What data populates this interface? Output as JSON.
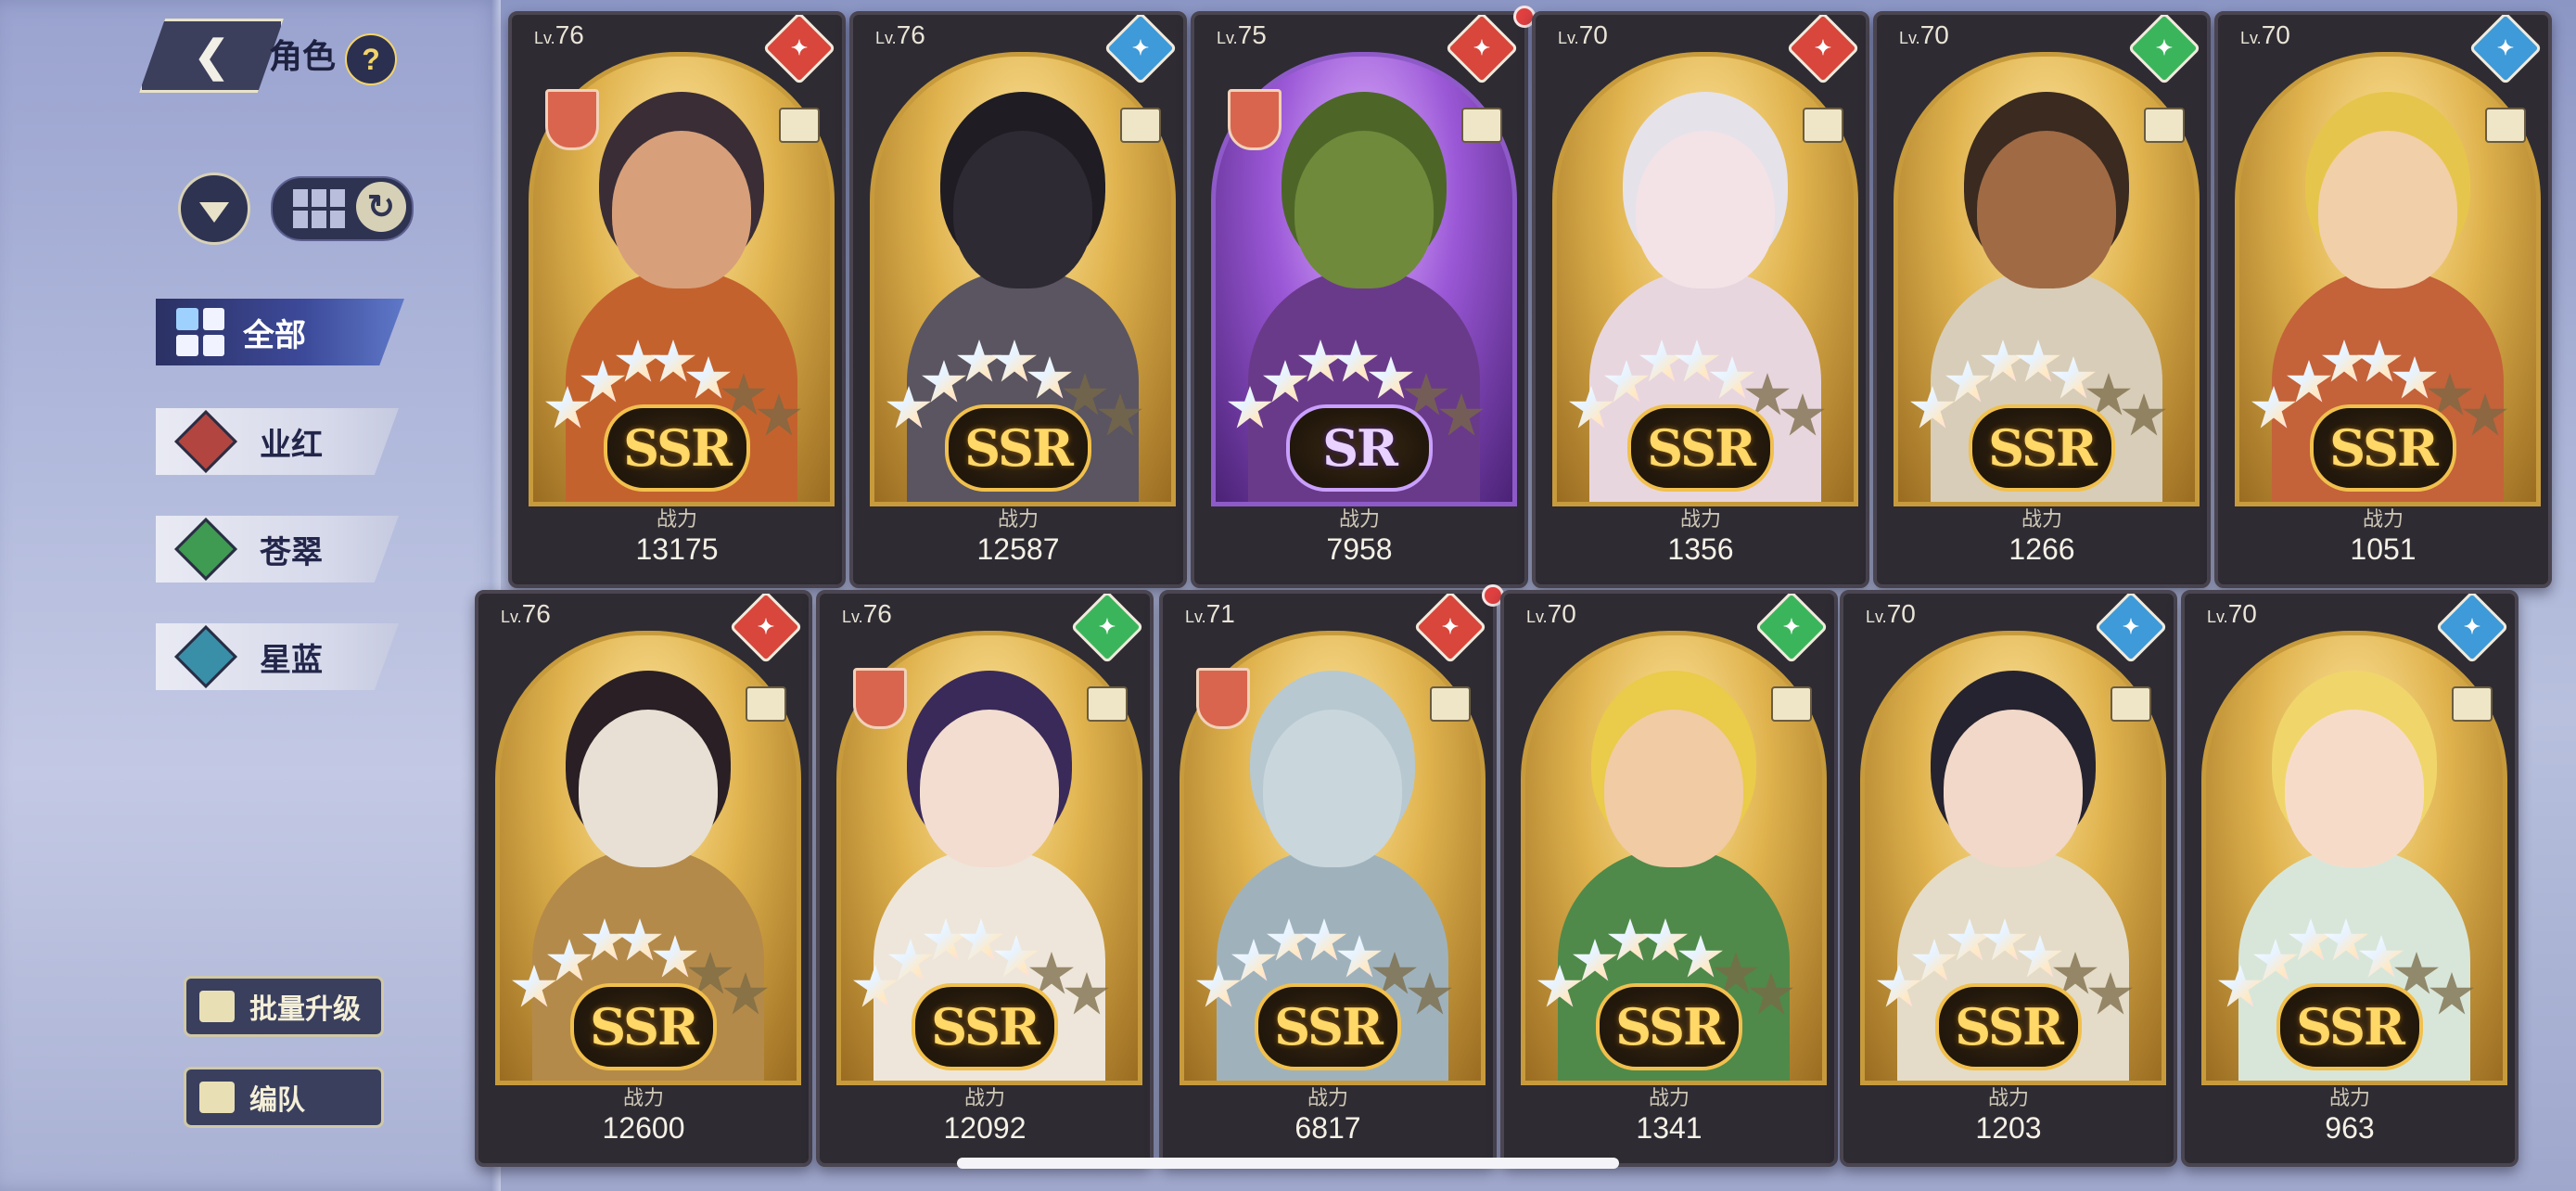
{
  "header": {
    "title": "角色",
    "help_icon": "?"
  },
  "filters": {
    "filter_icon": "filter-icon",
    "view_icon": "grid-view-icon",
    "refresh_icon": "refresh-icon"
  },
  "categories": [
    {
      "label": "全部",
      "active": true,
      "color": "#3d4a9a"
    },
    {
      "label": "业红",
      "active": false,
      "color": "#b2453f"
    },
    {
      "label": "苍翠",
      "active": false,
      "color": "#3f9a52"
    },
    {
      "label": "星蓝",
      "active": false,
      "color": "#3a8fa8"
    }
  ],
  "actions": {
    "batch_upgrade": "批量升级",
    "formation": "编队"
  },
  "power_label": "战力",
  "level_prefix": "Lv.",
  "attribute_colors": {
    "red": "#d8463c",
    "blue": "#3e9ad8",
    "green": "#3bb55c"
  },
  "cards": [
    {
      "level": "76",
      "power": "13175",
      "rarity": "SSR",
      "attribute": "red",
      "stars": 5,
      "badge": true,
      "skin": "#d7a07a",
      "outfit": "#c4622e",
      "hair": "#3a2d36"
    },
    {
      "level": "76",
      "power": "12587",
      "rarity": "SSR",
      "attribute": "blue",
      "stars": 5,
      "badge": false,
      "skin": "#2e2a34",
      "outfit": "#5a5560",
      "hair": "#1f1c24"
    },
    {
      "level": "75",
      "power": "7958",
      "rarity": "SR",
      "attribute": "red",
      "stars": 5,
      "badge": true,
      "skin": "#6f8a3a",
      "outfit": "#6a3a8a",
      "hair": "#4d6628",
      "notify": true
    },
    {
      "level": "70",
      "power": "1356",
      "rarity": "SSR",
      "attribute": "red",
      "stars": 5,
      "badge": false,
      "skin": "#f3e3e6",
      "outfit": "#e8d6de",
      "hair": "#e6e2ea"
    },
    {
      "level": "70",
      "power": "1266",
      "rarity": "SSR",
      "attribute": "green",
      "stars": 5,
      "badge": false,
      "skin": "#a06a44",
      "outfit": "#d8cdb8",
      "hair": "#3a2a20"
    },
    {
      "level": "70",
      "power": "1051",
      "rarity": "SSR",
      "attribute": "blue",
      "stars": 5,
      "badge": false,
      "skin": "#f1cfa8",
      "outfit": "#c4623a",
      "hair": "#e6c54c"
    },
    {
      "level": "76",
      "power": "12600",
      "rarity": "SSR",
      "attribute": "red",
      "stars": 5,
      "badge": false,
      "skin": "#e8e0d4",
      "outfit": "#b48a4a",
      "hair": "#2a1f24"
    },
    {
      "level": "76",
      "power": "12092",
      "rarity": "SSR",
      "attribute": "green",
      "stars": 5,
      "badge": true,
      "skin": "#f3ddd0",
      "outfit": "#eee6da",
      "hair": "#3a2a5a"
    },
    {
      "level": "71",
      "power": "6817",
      "rarity": "SSR",
      "attribute": "red",
      "stars": 5,
      "badge": true,
      "skin": "#c9d6dc",
      "outfit": "#9fb2bc",
      "hair": "#b7c8d0",
      "notify": true
    },
    {
      "level": "70",
      "power": "1341",
      "rarity": "SSR",
      "attribute": "green",
      "stars": 5,
      "badge": false,
      "skin": "#f0cba4",
      "outfit": "#4f8a4a",
      "hair": "#eacb4a"
    },
    {
      "level": "70",
      "power": "1203",
      "rarity": "SSR",
      "attribute": "blue",
      "stars": 5,
      "badge": false,
      "skin": "#f1d8c8",
      "outfit": "#e4dcc8",
      "hair": "#262330"
    },
    {
      "level": "70",
      "power": "963",
      "rarity": "SSR",
      "attribute": "blue",
      "stars": 5,
      "badge": false,
      "skin": "#f6dcc8",
      "outfit": "#d8e6da",
      "hair": "#f0d66a"
    }
  ]
}
